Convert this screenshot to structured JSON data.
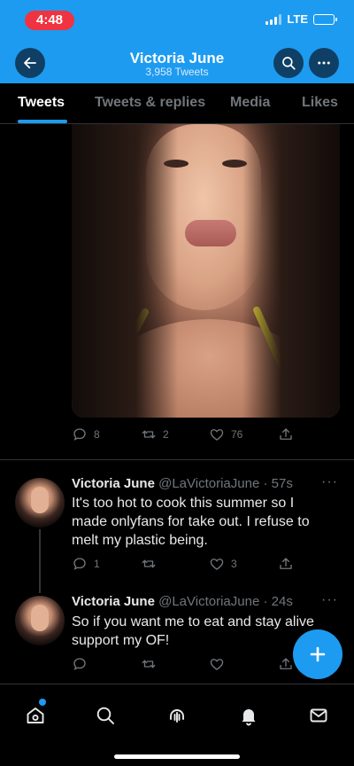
{
  "status_bar": {
    "time": "4:48",
    "network": "LTE"
  },
  "header": {
    "title": "Victoria June",
    "subtitle": "3,958 Tweets"
  },
  "tabs": [
    {
      "label": "Tweets",
      "active": true
    },
    {
      "label": "Tweets & replies",
      "active": false
    },
    {
      "label": "Media",
      "active": false
    },
    {
      "label": "Likes",
      "active": false
    }
  ],
  "media_tweet": {
    "replies": "8",
    "retweets": "2",
    "likes": "76"
  },
  "tweets": [
    {
      "name": "Victoria June",
      "handle": "@LaVictoriaJune",
      "time": "· 57s",
      "text": "It's too hot to cook this summer so I made onlyfans for take out. I refuse to melt my plastic being.",
      "replies": "1",
      "retweets": "",
      "likes": "3"
    },
    {
      "name": "Victoria June",
      "handle": "@LaVictoriaJune",
      "time": "· 24s",
      "text": "So if you want me to eat and stay alive support my OF!",
      "replies": "",
      "retweets": "",
      "likes": ""
    }
  ],
  "colors": {
    "accent": "#1d9bf0",
    "background": "#000000",
    "muted": "#71767b",
    "time_pill": "#ef3340"
  },
  "icons": [
    "back-arrow-icon",
    "search-icon",
    "more-icon",
    "reply-icon",
    "retweet-icon",
    "like-icon",
    "share-icon",
    "compose-icon",
    "home-icon",
    "explore-icon",
    "spaces-icon",
    "notifications-icon",
    "messages-icon"
  ]
}
